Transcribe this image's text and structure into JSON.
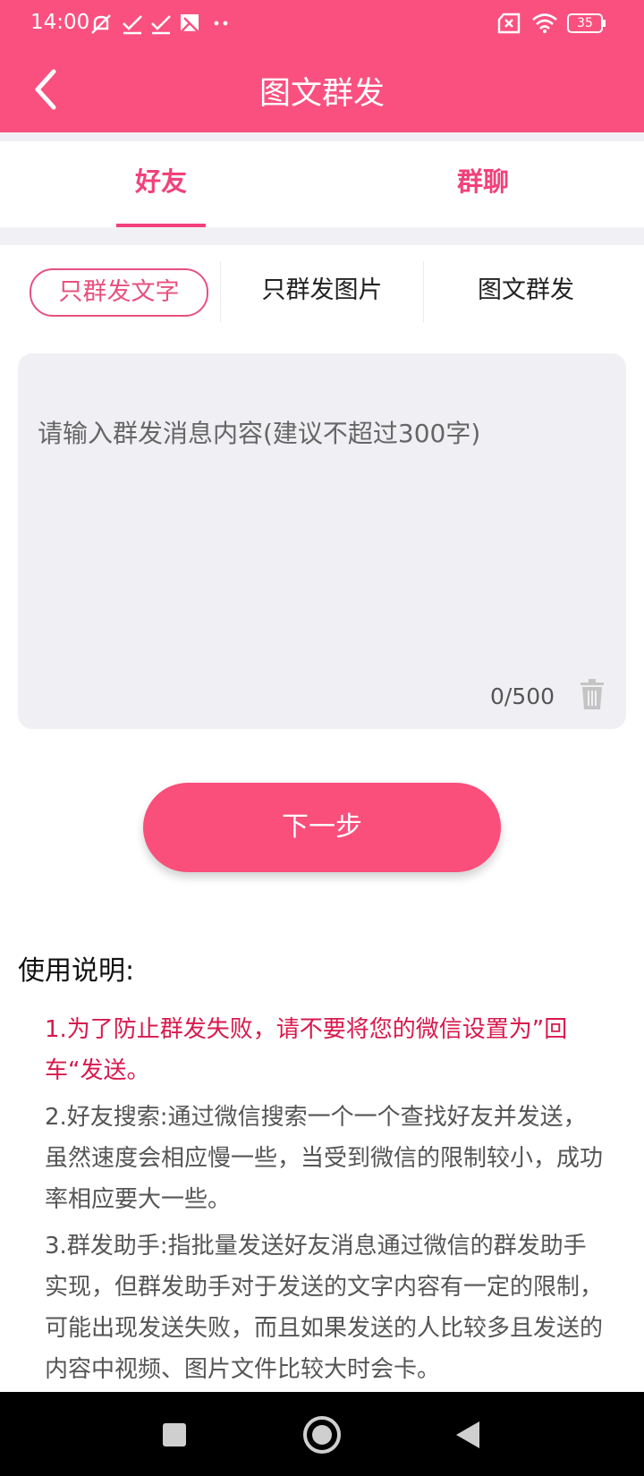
{
  "status_bar": {
    "time": "14:00",
    "battery": "35"
  },
  "header": {
    "title": "图文群发"
  },
  "tabs": [
    {
      "label": "好友",
      "active": true
    },
    {
      "label": "群聊",
      "active": false
    }
  ],
  "modes": [
    {
      "label": "只群发文字",
      "active": true
    },
    {
      "label": "只群发图片",
      "active": false
    },
    {
      "label": "图文群发",
      "active": false
    }
  ],
  "message_input": {
    "value": "",
    "placeholder": "请输入群发消息内容(建议不超过300字)",
    "counter": "0/500"
  },
  "next_button": {
    "label": "下一步"
  },
  "usage": {
    "title": "使用说明:",
    "items": [
      "1.为了防止群发失败，请不要将您的微信设置为”回车“发送。",
      "2.好友搜索:通过微信搜索一个一个查找好友并发送，虽然速度会相应慢一些，当受到微信的限制较小，成功率相应要大一些。",
      "3.群发助手:指批量发送好友消息通过微信的群发助手实现，但群发助手对于发送的文字内容有一定的限制，可能出现发送失败，而且如果发送的人比较多且发送的内容中视频、图片文件比较大时会卡。"
    ]
  },
  "colors": {
    "brand": "#fa507f",
    "accent_text": "#f2417a",
    "warning_text": "#d8194d",
    "input_bg": "#f0f0f4"
  },
  "icons": [
    "back-arrow-icon",
    "trash-icon",
    "wifi-icon",
    "battery-icon",
    "nav-home-icon",
    "nav-back-icon",
    "nav-recents-icon"
  ]
}
